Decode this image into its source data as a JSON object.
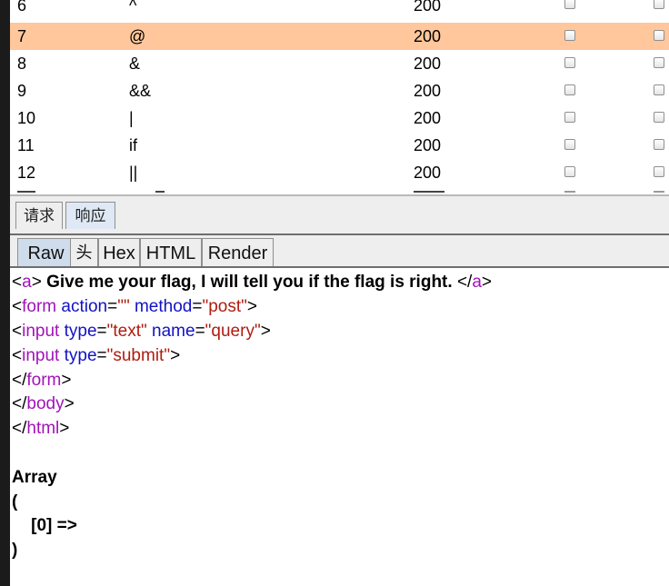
{
  "results_table": {
    "rows": [
      {
        "num": "6",
        "payload": "^",
        "status": "200",
        "selected": false
      },
      {
        "num": "7",
        "payload": "@",
        "status": "200",
        "selected": true
      },
      {
        "num": "8",
        "payload": "&",
        "status": "200",
        "selected": false
      },
      {
        "num": "9",
        "payload": "&&",
        "status": "200",
        "selected": false
      },
      {
        "num": "10",
        "payload": "|",
        "status": "200",
        "selected": false
      },
      {
        "num": "11",
        "payload": "if",
        "status": "200",
        "selected": false
      },
      {
        "num": "12",
        "payload": "||",
        "status": "200",
        "selected": false
      }
    ],
    "selection_color": "#ffc79b"
  },
  "outer_tabs": {
    "request": "请求",
    "response": "响应"
  },
  "inner_tabs": {
    "raw": "Raw",
    "headers": "头",
    "hex": "Hex",
    "html": "HTML",
    "render": "Render"
  },
  "response": {
    "l1": {
      "o1": "<",
      "t1": "a",
      "c1": ">",
      "text": " Give me your flag, I will tell you if the flag is right. ",
      "o2": "</",
      "t2": "a",
      "c2": ">"
    },
    "l2": {
      "o1": "<",
      "tag": "form",
      "s1": " ",
      "a1": "action",
      "e1": "=",
      "v1": "\"\"",
      "s2": " ",
      "a2": "method",
      "e2": "=",
      "v2": "\"post\"",
      "c1": ">"
    },
    "l3": {
      "o1": "<",
      "tag": "input",
      "s1": " ",
      "a1": "type",
      "e1": "=",
      "v1": "\"text\"",
      "s2": " ",
      "a2": "name",
      "e2": "=",
      "v2": "\"query\"",
      "c1": ">"
    },
    "l4": {
      "o1": "<",
      "tag": "input",
      "s1": " ",
      "a1": "type",
      "e1": "=",
      "v1": "\"submit\"",
      "c1": ">"
    },
    "l5": {
      "o1": "</",
      "tag": "form",
      "c1": ">"
    },
    "l6": {
      "o1": "</",
      "tag": "body",
      "c1": ">"
    },
    "l7": {
      "o1": "</",
      "tag": "html",
      "c1": ">"
    },
    "l8": "Array",
    "l9": "(",
    "l10": "    [0] => ",
    "l11": ")"
  },
  "colors": {
    "tag": "#a113b8",
    "attribute": "#1212c5",
    "value": "#b01c10"
  }
}
